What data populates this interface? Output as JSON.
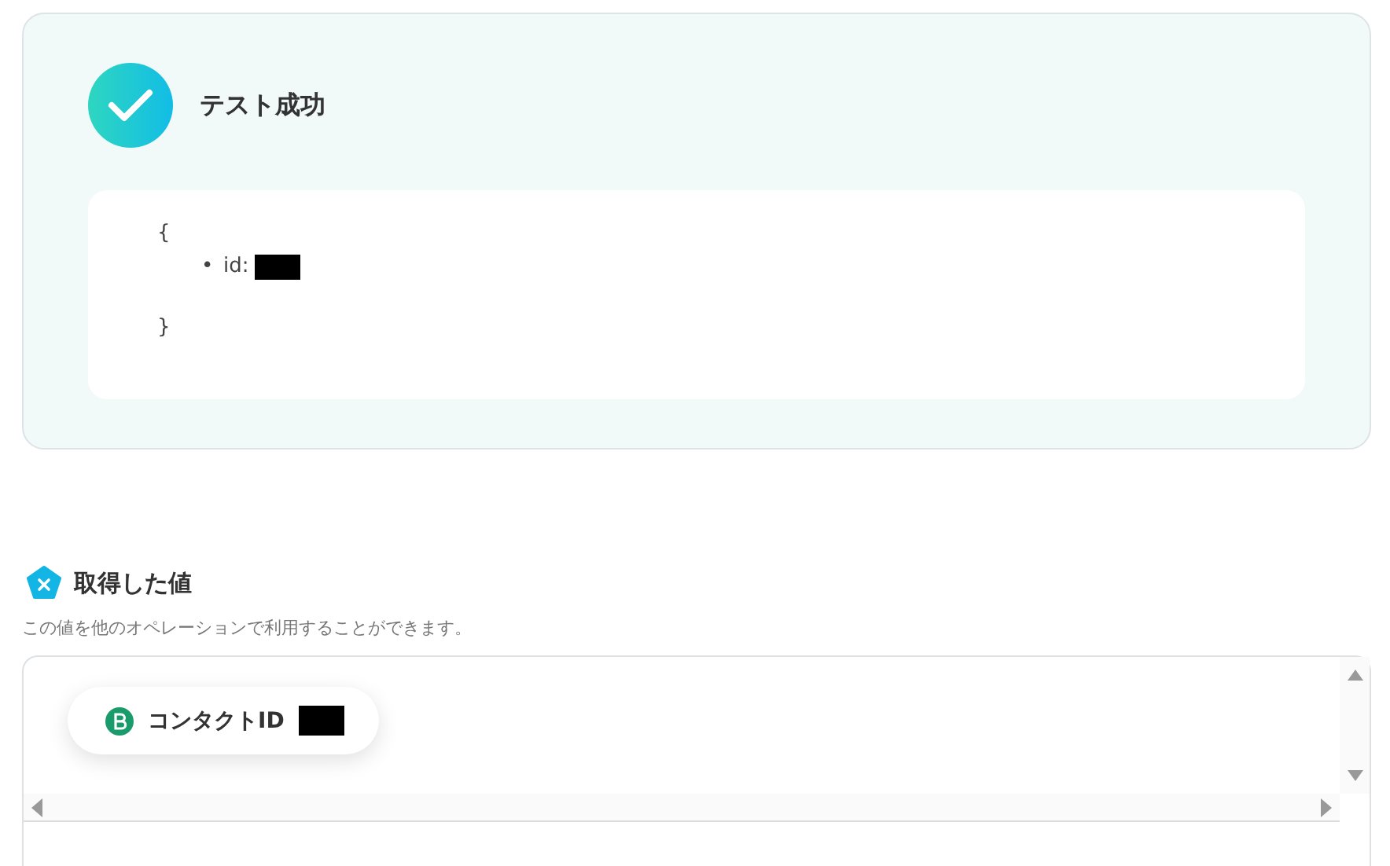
{
  "test_result": {
    "title": "テスト成功",
    "open_brace": "{",
    "fields": [
      {
        "bullet": "•",
        "label": "id:"
      }
    ],
    "close_brace": "}"
  },
  "values_section": {
    "title": "取得した値",
    "description": "この値を他のオペレーションで利用することができます。",
    "chips": [
      {
        "label": "コンタクトID"
      }
    ]
  }
}
